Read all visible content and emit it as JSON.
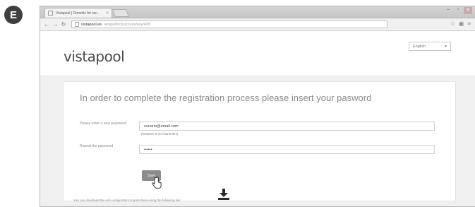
{
  "step_badge": "E",
  "browser": {
    "tab_title": "Vistapool | Domotic for sw...",
    "tab_close": "×",
    "url_host": "vistapool.es",
    "url_path": "/en/public/success/key/405",
    "icons": [
      "back-arrow-icon",
      "forward-arrow-icon",
      "reload-icon",
      "star-icon",
      "menu-icon"
    ]
  },
  "site": {
    "logo": "vistapool",
    "language": "English",
    "language_caret": "▾"
  },
  "form": {
    "heading": "In order to complete the registration process please insert your pasword",
    "new_password_label": "Please enter a new password",
    "new_password_value": "usuario@email.com",
    "password_hint": "(between 6-10 characters)",
    "repeat_password_label": "Repeat the password",
    "repeat_password_value": "••••••",
    "save_label": "Save"
  },
  "footer": {
    "download_text": "You can download the wifi configurator program here using the following link"
  }
}
